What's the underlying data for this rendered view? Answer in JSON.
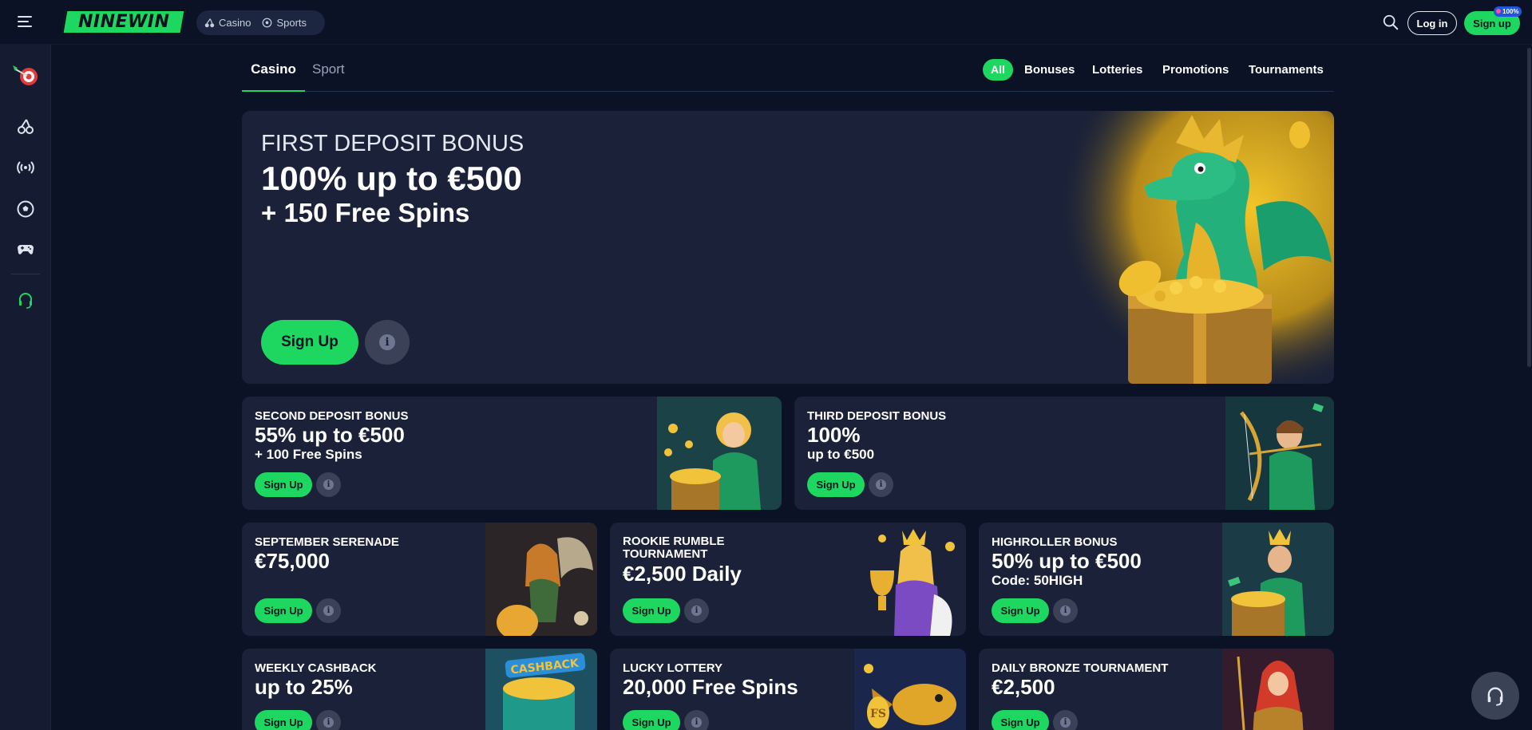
{
  "header": {
    "logo_text": "NINEWIN",
    "modes": [
      {
        "label": "Casino",
        "icon": "cherries-icon"
      },
      {
        "label": "Sports",
        "icon": "soccer-ball-icon"
      }
    ],
    "login_label": "Log in",
    "signup_label": "Sign up",
    "signup_badge": "100%"
  },
  "sidebar": {
    "items": [
      {
        "icon": "dart-target-icon"
      },
      {
        "icon": "cherries-icon"
      },
      {
        "icon": "live-broadcast-icon"
      },
      {
        "icon": "soccer-ball-icon"
      },
      {
        "icon": "gamepad-icon"
      },
      {
        "icon": "headset-support-icon"
      }
    ]
  },
  "subnav": {
    "tabs": [
      "Casino",
      "Sport"
    ],
    "active_tab": "Casino",
    "filters": [
      "All",
      "Bonuses",
      "Lotteries",
      "Promotions",
      "Tournaments"
    ],
    "active_filter": "All"
  },
  "hero": {
    "title": "FIRST DEPOSIT BONUS",
    "line1": "100% up to €500",
    "line2": "+ 150 Free Spins",
    "button": "Sign Up"
  },
  "promos": [
    {
      "title": "SECOND DEPOSIT BONUS",
      "main": "55% up to €500",
      "sub": "+ 100 Free Spins",
      "button": "Sign Up"
    },
    {
      "title": "THIRD DEPOSIT BONUS",
      "main": "100%",
      "sub": "up to €500",
      "button": "Sign Up"
    },
    {
      "title": "SEPTEMBER SERENADE",
      "main": "€75,000",
      "sub": "",
      "button": "Sign Up"
    },
    {
      "title": "ROOKIE RUMBLE TOURNAMENT",
      "main": "€2,500 Daily",
      "sub": "",
      "button": "Sign Up"
    },
    {
      "title": "HIGHROLLER BONUS",
      "main": "50% up to €500",
      "sub": "Code: 50HIGH",
      "button": "Sign Up"
    },
    {
      "title": "WEEKLY CASHBACK",
      "main": "up to 25%",
      "sub": "",
      "button": "Sign Up",
      "art_label": "CASHBACK"
    },
    {
      "title": "LUCKY LOTTERY",
      "main": "20,000 Free Spins",
      "sub": "",
      "button": "Sign Up",
      "art_label": "FS"
    },
    {
      "title": "DAILY BRONZE TOURNAMENT",
      "main": "€2,500",
      "sub": "",
      "button": "Sign Up"
    }
  ],
  "colors": {
    "background": "#0b1226",
    "card": "#1a2138",
    "accent": "#1ed760",
    "sidebar": "#151c31"
  }
}
